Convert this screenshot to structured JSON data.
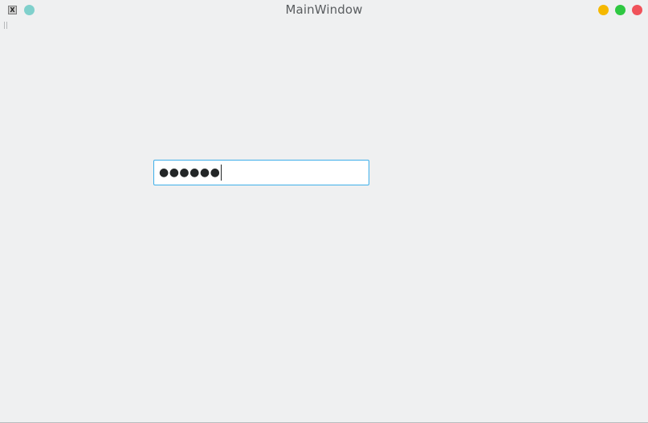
{
  "window": {
    "title": "MainWindow",
    "app_icon_glyph": "X",
    "buttons": {
      "minimize_color": "#f5b800",
      "maximize_color": "#2ec842",
      "close_color": "#f0525a",
      "pin_color": "#7fd0cc"
    }
  },
  "form": {
    "password_masked": "●●●●●●",
    "focus_color": "#3daee9"
  }
}
